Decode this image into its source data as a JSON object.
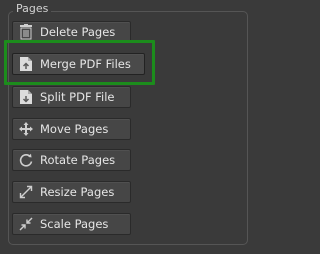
{
  "panel": {
    "title": "Pages"
  },
  "buttons": [
    {
      "label": "Delete Pages",
      "icon": "trash-icon"
    },
    {
      "label": "Merge PDF Files",
      "icon": "merge-pdf-icon"
    },
    {
      "label": "Split PDF File",
      "icon": "split-pdf-icon"
    },
    {
      "label": "Move Pages",
      "icon": "move-icon"
    },
    {
      "label": "Rotate Pages",
      "icon": "rotate-icon"
    },
    {
      "label": "Resize Pages",
      "icon": "resize-icon"
    },
    {
      "label": "Scale Pages",
      "icon": "scale-icon"
    }
  ],
  "colors": {
    "background": "#3a3a3a",
    "button": "#464646",
    "text": "#e6e6e6",
    "highlight": "#1c8c1c"
  }
}
